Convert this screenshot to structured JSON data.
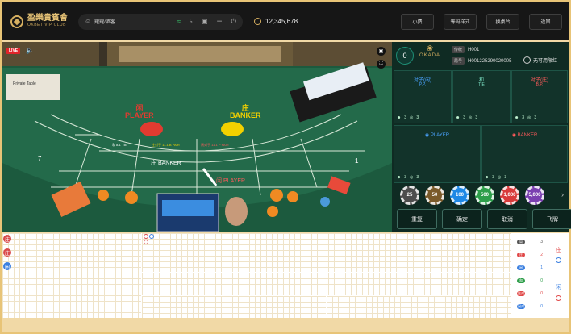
{
  "brand": {
    "cn": "盈樂貴賓會",
    "en": "OKBET VIP CLUB"
  },
  "user": {
    "name": "耀耀/酒客",
    "balance": "12,345,678"
  },
  "header_buttons": [
    "小费",
    "筹码样式",
    "换桌台",
    "返回"
  ],
  "video": {
    "live": "LIVE"
  },
  "table": {
    "round": "0",
    "brand": "OKADA",
    "tag_table": "传统",
    "table_id": "H001",
    "tag_shoe": "局号",
    "shoe_id": "H001225290020005",
    "limit_text": "无可用限红"
  },
  "zones": [
    {
      "cn": "对子(闲)",
      "en": "P.P.",
      "color": "blue",
      "players": "3",
      "amount": "3"
    },
    {
      "cn": "和",
      "en": "TIE",
      "color": "teal",
      "players": "3",
      "amount": "3"
    },
    {
      "cn": "对子(庄)",
      "en": "B.P.",
      "color": "red",
      "players": "3",
      "amount": "3"
    },
    {
      "cn": "PLAYER",
      "en": "",
      "color": "blue",
      "players": "3",
      "amount": "3"
    },
    {
      "cn": "BANKER",
      "en": "",
      "color": "red",
      "players": "3",
      "amount": "3"
    }
  ],
  "chips": [
    {
      "value": "25",
      "color": "#4d4d4d"
    },
    {
      "value": "50",
      "color": "#7a5a2a"
    },
    {
      "value": "100",
      "color": "#1e88e5"
    },
    {
      "value": "500",
      "color": "#2e9e4a"
    },
    {
      "value": "1,000",
      "color": "#d83b3b"
    },
    {
      "value": "5,000",
      "color": "#7a3fb0"
    }
  ],
  "actions": [
    "重复",
    "确定",
    "取消",
    "飞牌"
  ],
  "roadmap": {
    "bead": [
      "庄",
      "庄",
      "闲"
    ],
    "bead_colors": [
      "#d94a4a",
      "#d94a4a",
      "#3a7fe0"
    ]
  },
  "stats": [
    {
      "label": "局",
      "value": "3",
      "color": "#555555"
    },
    {
      "label": "庄",
      "value": "2",
      "color": "#e04848"
    },
    {
      "label": "闲",
      "value": "1",
      "color": "#3a7fe0"
    },
    {
      "label": "和",
      "value": "0",
      "color": "#2e9e4a"
    },
    {
      "label": "庄对",
      "value": "0",
      "color": "#e04848"
    },
    {
      "label": "闲对",
      "value": "0",
      "color": "#3a7fe0"
    }
  ],
  "ask": {
    "banker": "庄",
    "player": "闲"
  },
  "felt": {
    "player": "闲\nPLAYER",
    "banker": "庄\nBANKER",
    "tie": "和 8-1 TIE",
    "pair_p": "闲对子 11-1 P PAIR",
    "pair_b": "庄对子 11-1 B PAIR",
    "num1": "1",
    "num7": "7",
    "banker_seat": "庄 BANKER",
    "player_seat": "闲 PLAYER",
    "table_sign": "Private Table"
  }
}
